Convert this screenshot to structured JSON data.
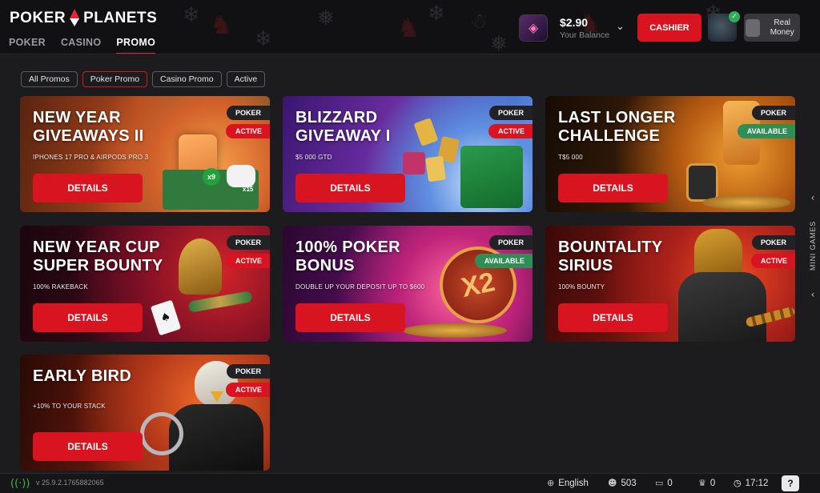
{
  "header": {
    "logo_left": "POKER",
    "logo_right": "PLANETS",
    "nav": [
      {
        "label": "POKER",
        "active": false
      },
      {
        "label": "CASINO",
        "active": false
      },
      {
        "label": "PROMO",
        "active": true
      }
    ],
    "balance": {
      "amount": "$2.90",
      "label": "Your Balance"
    },
    "cashier_label": "CASHIER",
    "real_money_label": "Real Money",
    "accent_color": "#d7141f"
  },
  "filters": [
    {
      "label": "All Promos",
      "active": false
    },
    {
      "label": "Poker Promo",
      "active": true
    },
    {
      "label": "Casino Promo",
      "active": false
    },
    {
      "label": "Active",
      "active": false
    }
  ],
  "promos": [
    {
      "title": "NEW YEAR\nGIVEAWAYS II",
      "subtitle": "IPHONES 17 PRO & AIRPODS PRO 3",
      "type": "POKER",
      "status": "ACTIVE",
      "button": "DETAILS"
    },
    {
      "title": "BLIZZARD\nGIVEAWAY I",
      "subtitle": "$5 000 GTD",
      "type": "POKER",
      "status": "ACTIVE",
      "button": "DETAILS"
    },
    {
      "title": "LAST LONGER\nCHALLENGE",
      "subtitle": "T$5 000",
      "type": "POKER",
      "status": "AVAILABLE",
      "button": "DETAILS"
    },
    {
      "title": "NEW YEAR CUP\nSUPER BOUNTY",
      "subtitle": "100% RAKEBACK",
      "type": "POKER",
      "status": "ACTIVE",
      "button": "DETAILS"
    },
    {
      "title": "100% POKER\nBONUS",
      "subtitle": "DOUBLE UP YOUR DEPOSIT UP TO $600",
      "type": "POKER",
      "status": "AVAILABLE",
      "button": "DETAILS"
    },
    {
      "title": "BOUNTALITY\nSIRIUS",
      "subtitle": "100% BOUNTY",
      "type": "POKER",
      "status": "ACTIVE",
      "button": "DETAILS"
    },
    {
      "title": "EARLY BIRD",
      "subtitle": "+10% TO YOUR STACK",
      "type": "POKER",
      "status": "ACTIVE",
      "button": "DETAILS"
    }
  ],
  "art_text": {
    "x9": "x9",
    "x15": "x15",
    "x2": "X2"
  },
  "side_tab": {
    "label": "MINI GAMES"
  },
  "footer": {
    "version": "v 25.9.2.1765882065",
    "language": "English",
    "players": "503",
    "tables": "0",
    "tournaments": "0",
    "time": "17:12",
    "help": "?"
  }
}
